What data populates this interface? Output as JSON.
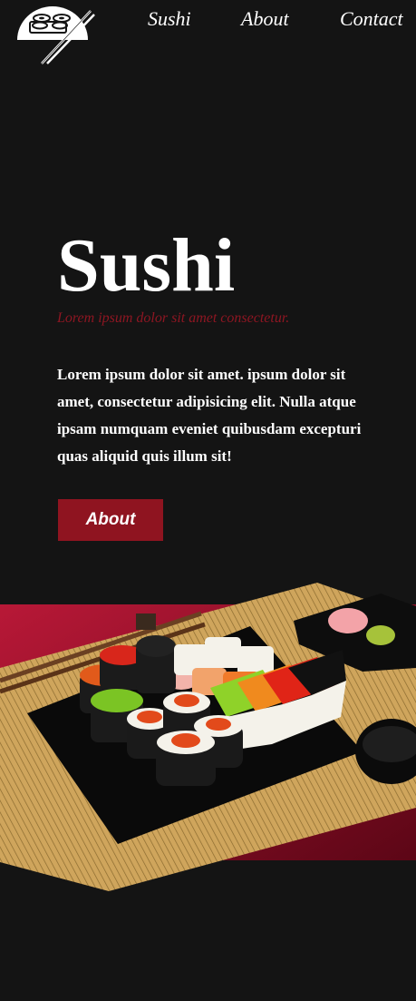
{
  "nav": {
    "items": [
      {
        "label": "Sushi"
      },
      {
        "label": "About"
      },
      {
        "label": "Contact"
      }
    ]
  },
  "hero": {
    "title": "Sushi",
    "subtitle": "Lorem ipsum dolor sit amet consectetur.",
    "body": "Lorem ipsum dolor sit amet. ipsum dolor sit amet, consectetur adipisicing elit. Nulla atque ipsam numquam eveniet quibusdam excepturi quas aliquid quis illum sit!",
    "button_label": "About"
  },
  "icons": {
    "logo": "sushi-chopsticks-logo",
    "photo": "sushi-platter-photo"
  },
  "colors": {
    "background": "#141414",
    "accent": "#8f1420",
    "text": "#ffffff"
  }
}
